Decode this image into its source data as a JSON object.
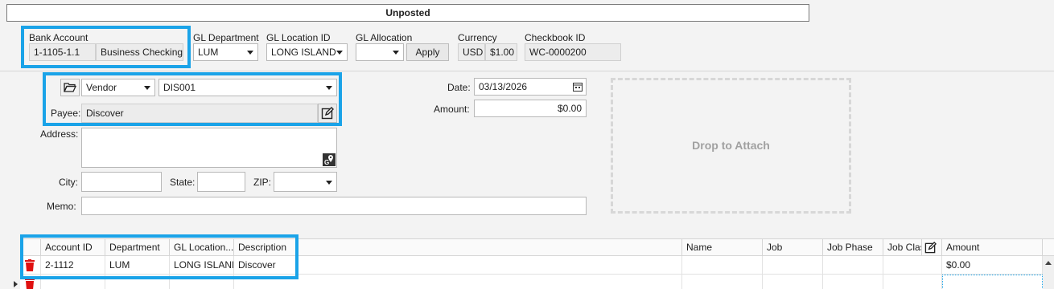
{
  "status_banner": "Unposted",
  "bank": {
    "label": "Bank Account",
    "account": "1-1105-1.1",
    "account_name": "Business Checking"
  },
  "gl_department": {
    "label": "GL Department",
    "value": "LUM"
  },
  "gl_location": {
    "label": "GL Location ID",
    "value": "LONG ISLAND"
  },
  "gl_allocation": {
    "label": "GL Allocation",
    "value": "",
    "apply_label": "Apply"
  },
  "currency": {
    "label": "Currency",
    "code": "USD",
    "rate": "$1.00"
  },
  "checkbook": {
    "label": "Checkbook ID",
    "value": "WC-0000200"
  },
  "payee_section": {
    "payee_type": "Vendor",
    "vendor_id": "DIS001",
    "payee_label": "Payee:",
    "payee_value": "Discover"
  },
  "date": {
    "label": "Date:",
    "value": "03/13/2026"
  },
  "amount": {
    "label": "Amount:",
    "value": "$0.00"
  },
  "address": {
    "label": "Address:",
    "value": ""
  },
  "city": {
    "label": "City:",
    "value": ""
  },
  "state": {
    "label": "State:",
    "value": ""
  },
  "zip": {
    "label": "ZIP:",
    "value": ""
  },
  "memo": {
    "label": "Memo:",
    "value": ""
  },
  "attach": {
    "label": "Drop to Attach"
  },
  "grid": {
    "columns": {
      "account_id": "Account ID",
      "department": "Department",
      "gl_location": "GL Location...",
      "description": "Description",
      "name": "Name",
      "job": "Job",
      "job_phase": "Job Phase",
      "job_class": "Job Clas",
      "amount": "Amount"
    },
    "rows": [
      {
        "account_id": "2-1112",
        "department": "LUM",
        "gl_location": "LONG ISLAND",
        "description": "Discover",
        "name": "",
        "job": "",
        "job_phase": "",
        "job_class": "",
        "amount": "$0.00"
      }
    ]
  },
  "colors": {
    "highlight": "#1aa3e8",
    "delete": "#e01010"
  },
  "icons": [
    "folder-open-icon",
    "edit-icon",
    "map-pin-icon",
    "calendar-icon",
    "trash-icon"
  ]
}
